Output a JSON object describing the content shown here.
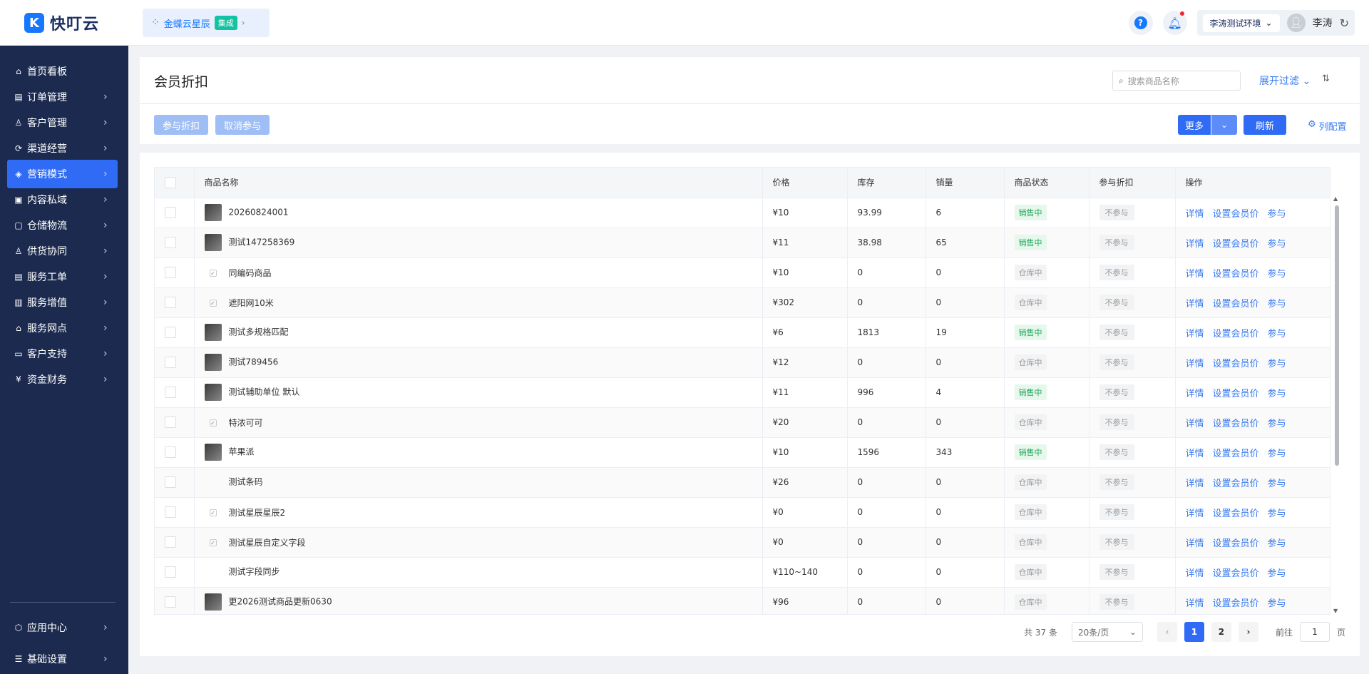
{
  "app": {
    "logo_text": "快叮云",
    "integration_name": "金蝶云星辰",
    "integration_badge": "集成"
  },
  "header": {
    "env": "李涛测试环境",
    "user_name": "李涛"
  },
  "sidebar": {
    "items": [
      {
        "label": "首页看板",
        "icon": "home-icon",
        "has_arrow": false
      },
      {
        "label": "订单管理",
        "icon": "order-icon",
        "has_arrow": true
      },
      {
        "label": "客户管理",
        "icon": "user-icon",
        "has_arrow": true
      },
      {
        "label": "渠道经营",
        "icon": "channel-icon",
        "has_arrow": true
      },
      {
        "label": "营销模式",
        "icon": "tag-icon",
        "has_arrow": true,
        "active": true
      },
      {
        "label": "内容私域",
        "icon": "image-icon",
        "has_arrow": true
      },
      {
        "label": "仓储物流",
        "icon": "warehouse-icon",
        "has_arrow": true
      },
      {
        "label": "供货协同",
        "icon": "supply-icon",
        "has_arrow": true
      },
      {
        "label": "服务工单",
        "icon": "ticket-icon",
        "has_arrow": true
      },
      {
        "label": "服务增值",
        "icon": "bag-icon",
        "has_arrow": true
      },
      {
        "label": "服务网点",
        "icon": "store-icon",
        "has_arrow": true
      },
      {
        "label": "客户支持",
        "icon": "support-icon",
        "has_arrow": true
      },
      {
        "label": "资金财务",
        "icon": "finance-icon",
        "has_arrow": true
      }
    ],
    "bottom_items": [
      {
        "label": "应用中心",
        "icon": "app-icon"
      },
      {
        "label": "基础设置",
        "icon": "settings-icon"
      }
    ]
  },
  "page": {
    "title": "会员折扣",
    "search_placeholder": "搜索商品名称",
    "filter_toggle": "展开过滤",
    "btn_join": "参与折扣",
    "btn_cancel": "取消参与",
    "btn_more": "更多",
    "btn_refresh": "刷新",
    "col_config": "列配置"
  },
  "table": {
    "columns": [
      "商品名称",
      "价格",
      "库存",
      "销量",
      "商品状态",
      "参与折扣",
      "操作"
    ],
    "ops": [
      "详情",
      "设置会员价",
      "参与"
    ],
    "rows": [
      {
        "name": "20260824001",
        "price": "¥10",
        "stock": "93.99",
        "sales": "6",
        "status": "销售中",
        "on": true,
        "join": "不参与",
        "thumb": "img"
      },
      {
        "name": "测试147258369",
        "price": "¥11",
        "stock": "38.98",
        "sales": "65",
        "status": "销售中",
        "on": true,
        "join": "不参与",
        "thumb": "img"
      },
      {
        "name": "同编码商品",
        "price": "¥10",
        "stock": "0",
        "sales": "0",
        "status": "仓库中",
        "on": false,
        "join": "不参与",
        "thumb": "empty"
      },
      {
        "name": "遮阳网10米",
        "price": "¥302",
        "stock": "0",
        "sales": "0",
        "status": "仓库中",
        "on": false,
        "join": "不参与",
        "thumb": "empty"
      },
      {
        "name": "测试多规格匹配",
        "price": "¥6",
        "stock": "1813",
        "sales": "19",
        "status": "销售中",
        "on": true,
        "join": "不参与",
        "thumb": "img"
      },
      {
        "name": "测试789456",
        "price": "¥12",
        "stock": "0",
        "sales": "0",
        "status": "仓库中",
        "on": false,
        "join": "不参与",
        "thumb": "img"
      },
      {
        "name": "测试辅助单位 默认",
        "price": "¥11",
        "stock": "996",
        "sales": "4",
        "status": "销售中",
        "on": true,
        "join": "不参与",
        "thumb": "img"
      },
      {
        "name": "特浓可可",
        "price": "¥20",
        "stock": "0",
        "sales": "0",
        "status": "仓库中",
        "on": false,
        "join": "不参与",
        "thumb": "empty"
      },
      {
        "name": "苹果派",
        "price": "¥10",
        "stock": "1596",
        "sales": "343",
        "status": "销售中",
        "on": true,
        "join": "不参与",
        "thumb": "img"
      },
      {
        "name": "测试条码",
        "price": "¥26",
        "stock": "0",
        "sales": "0",
        "status": "仓库中",
        "on": false,
        "join": "不参与",
        "thumb": "none"
      },
      {
        "name": "测试星辰星辰2",
        "price": "¥0",
        "stock": "0",
        "sales": "0",
        "status": "仓库中",
        "on": false,
        "join": "不参与",
        "thumb": "empty"
      },
      {
        "name": "测试星辰自定义字段",
        "price": "¥0",
        "stock": "0",
        "sales": "0",
        "status": "仓库中",
        "on": false,
        "join": "不参与",
        "thumb": "empty"
      },
      {
        "name": "测试字段同步",
        "price": "¥110~140",
        "stock": "0",
        "sales": "0",
        "status": "仓库中",
        "on": false,
        "join": "不参与",
        "thumb": "none"
      },
      {
        "name": "更2026测试商品更新0630",
        "price": "¥96",
        "stock": "0",
        "sales": "0",
        "status": "仓库中",
        "on": false,
        "join": "不参与",
        "thumb": "img"
      }
    ]
  },
  "pager": {
    "total": "共 37 条",
    "page_size": "20条/页",
    "pages": [
      "1",
      "2"
    ],
    "current": "1",
    "goto_label": "前往",
    "goto_value": "1",
    "page_unit": "页"
  }
}
